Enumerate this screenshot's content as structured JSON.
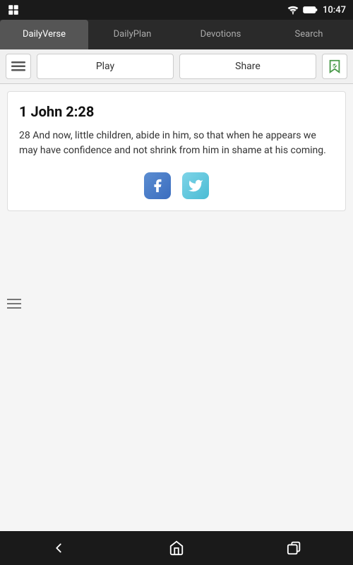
{
  "statusBar": {
    "time": "10:47",
    "wifiIcon": "wifi-icon",
    "batteryIcon": "battery-icon"
  },
  "tabs": [
    {
      "id": "daily-verse",
      "label": "DailyVerse",
      "active": true
    },
    {
      "id": "daily-plan",
      "label": "DailyPlan",
      "active": false
    },
    {
      "id": "devotions",
      "label": "Devotions",
      "active": false
    },
    {
      "id": "search",
      "label": "Search",
      "active": false
    }
  ],
  "actionBar": {
    "playLabel": "Play",
    "shareLabel": "Share"
  },
  "verse": {
    "title": "1 John 2:28",
    "text": "28 And now, little children, abide in him, so that when he appears we may have confidence and not shrink from him in shame at his coming."
  },
  "social": {
    "facebookLabel": "Facebook",
    "twitterLabel": "Twitter"
  },
  "navigation": {
    "backIcon": "back-icon",
    "homeIcon": "home-icon",
    "recentIcon": "recent-apps-icon"
  }
}
